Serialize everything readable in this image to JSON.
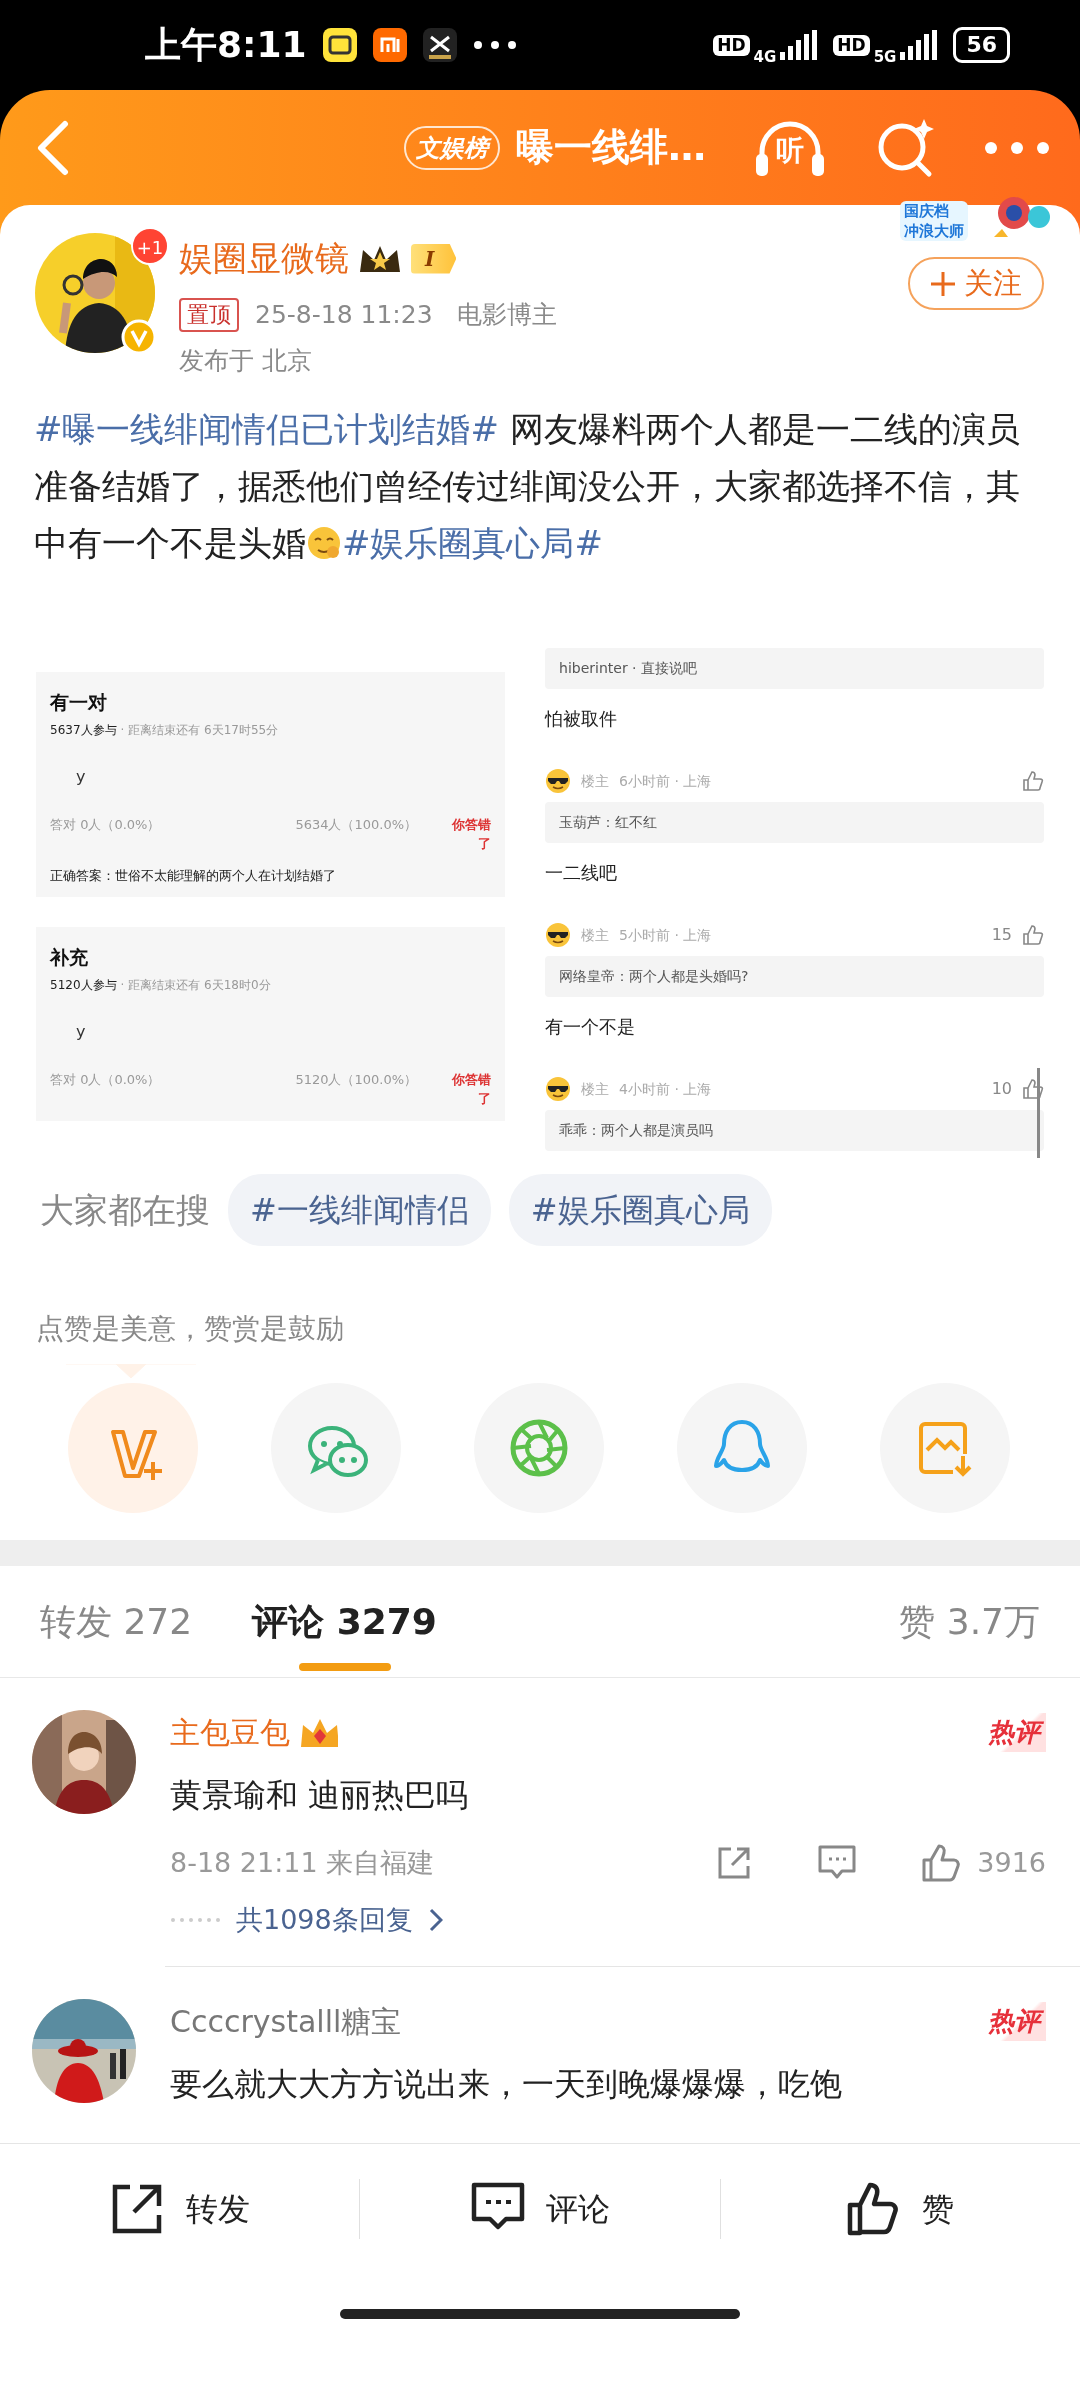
{
  "status_bar": {
    "time": "上午8:11",
    "signals": [
      {
        "hd": "HD",
        "network": "4G"
      },
      {
        "hd": "HD",
        "network": "5G"
      }
    ],
    "battery": "56"
  },
  "header": {
    "badge": "文娱榜",
    "title": "曝一线绯…",
    "listen": "听"
  },
  "post": {
    "author": "娱圈显微镜",
    "avatar_badge": "+1",
    "level": "I",
    "sticker": [
      "国庆档",
      "冲浪大师"
    ],
    "follow": "关注",
    "pinned": "置顶",
    "time": "25-8-18 11:23",
    "role": "电影博主",
    "location": "发布于 北京",
    "text": [
      {
        "kind": "topic",
        "text": "#曝一线绯闻情侣已计划结婚#"
      },
      {
        "kind": "plain",
        "text": " 网友爆料两个人都是一二线的演员准备结婚了，据悉他们曾经传过绯闻没公开，大家都选择不信，其中有一个不是头婚"
      },
      {
        "kind": "emoji"
      },
      {
        "kind": "topic",
        "text": "#娱乐圈真心局#"
      }
    ]
  },
  "images": [
    {
      "kind": "quiz_list",
      "quizzes": [
        {
          "title": "有一对",
          "participants": "5637人参与",
          "remaining": "· 距离结束还有 6天17时55分",
          "option": "y",
          "correct": "答对  0人（0.0%）",
          "wrong": "5634人（100.0%）",
          "verdict": "你答错了",
          "answer": "正确答案：世俗不太能理解的两个人在计划结婚了"
        },
        {
          "title": "补充",
          "participants": "5120人参与",
          "remaining": "· 距离结束还有 6天18时0分",
          "option": "y",
          "correct": "答对  0人（0.0%）",
          "wrong": "5120人（100.0%）",
          "verdict": "你答错了"
        }
      ]
    },
    {
      "kind": "thread",
      "items": [
        {
          "kind": "quote",
          "text": "hiberinter · 直接说吧"
        },
        {
          "kind": "reply",
          "text": "怕被取件"
        },
        {
          "kind": "header",
          "author": "楼主",
          "time": "6小时前 · 上海"
        },
        {
          "kind": "quote",
          "text": "玉葫芦：红不红"
        },
        {
          "kind": "reply",
          "text": "一二线吧"
        },
        {
          "kind": "header",
          "author": "楼主",
          "time": "5小时前 · 上海",
          "likes": "15"
        },
        {
          "kind": "quote",
          "text": "网络皇帝：两个人都是头婚吗?"
        },
        {
          "kind": "reply",
          "text": "有一个不是"
        },
        {
          "kind": "header",
          "author": "楼主",
          "time": "4小时前 · 上海",
          "likes": "10"
        },
        {
          "kind": "quote",
          "text": "乖乖：两个人都是演员吗"
        }
      ]
    }
  ],
  "searches": {
    "label": "大家都在搜",
    "tags": [
      "#一线绯闻情侣",
      "#娱乐圈真心局"
    ]
  },
  "reward_prompt": "点赞是美意，赞赏是鼓励",
  "share_targets": [
    {
      "kind": "reward"
    },
    {
      "kind": "wechat"
    },
    {
      "kind": "moments"
    },
    {
      "kind": "qq"
    },
    {
      "kind": "save_image"
    }
  ],
  "tabs": [
    {
      "label": "转发",
      "count": "272",
      "selected": false
    },
    {
      "label": "评论",
      "count": "3279",
      "selected": true
    }
  ],
  "likes": {
    "label": "赞",
    "count": "3.7万"
  },
  "comments": [
    {
      "user": "主包豆包",
      "vip": true,
      "badge": "热评",
      "text": "黄景瑜和 迪丽热巴吗",
      "time": "8-18 21:11 来自福建",
      "likes": "3916",
      "replies": "共1098条回复"
    },
    {
      "user": "Ccccrystalll糖宝",
      "vip": false,
      "badge": "热评",
      "text": "要么就大大方方说出来，一天到晚爆爆爆，吃饱"
    }
  ],
  "bottom_bar": [
    {
      "kind": "repost",
      "label": "转发"
    },
    {
      "kind": "comment",
      "label": "评论"
    },
    {
      "kind": "like",
      "label": "赞"
    }
  ]
}
